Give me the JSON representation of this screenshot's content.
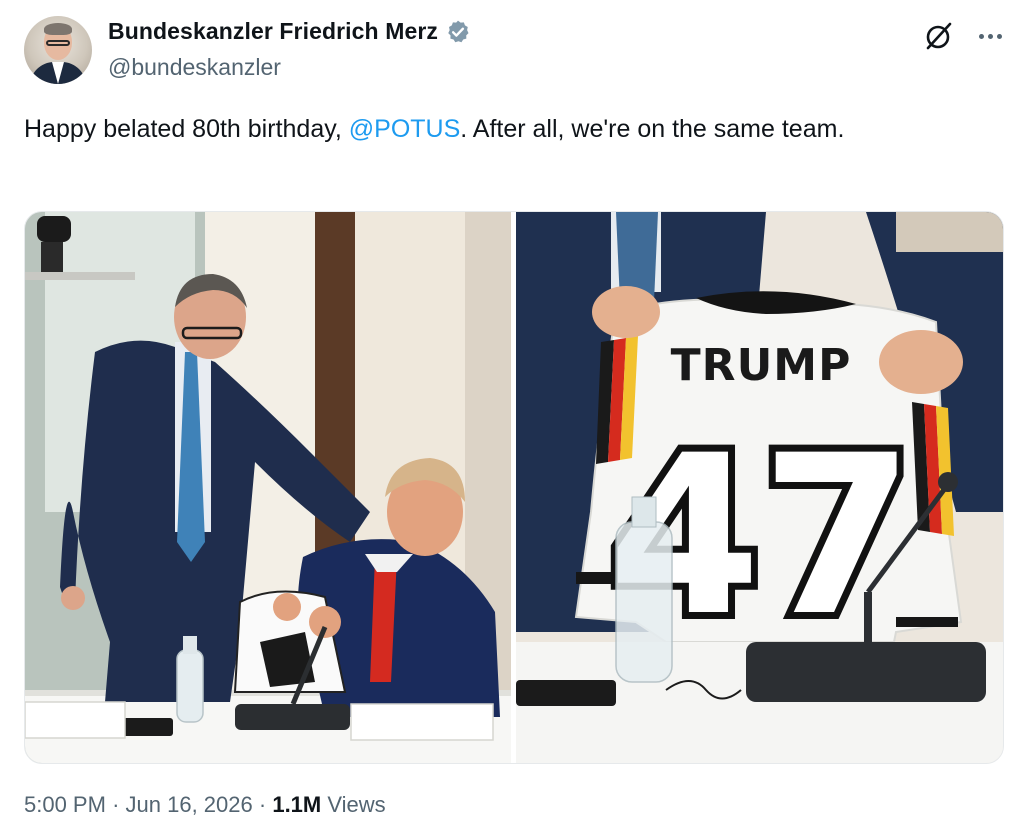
{
  "author": {
    "display_name": "Bundeskanzler Friedrich Merz",
    "handle": "@bundeskanzler",
    "verified": true
  },
  "tweet": {
    "text_before": "Happy belated 80th birthday, ",
    "mention": "@POTUS",
    "text_after": ". After all, we're on the same team."
  },
  "media": {
    "photo_right": {
      "jersey_name": "TRUMP",
      "jersey_number": "47"
    }
  },
  "meta": {
    "time": "5:00 PM",
    "separator": "·",
    "date": "Jun 16, 2026",
    "views_count": "1.1M",
    "views_label": "Views"
  },
  "colors": {
    "accent": "#1d9bf0",
    "verified_badge": "#829aab",
    "muted_text": "#536471"
  },
  "icons": [
    "verified-badge-icon",
    "grok-icon",
    "more-options-icon"
  ]
}
